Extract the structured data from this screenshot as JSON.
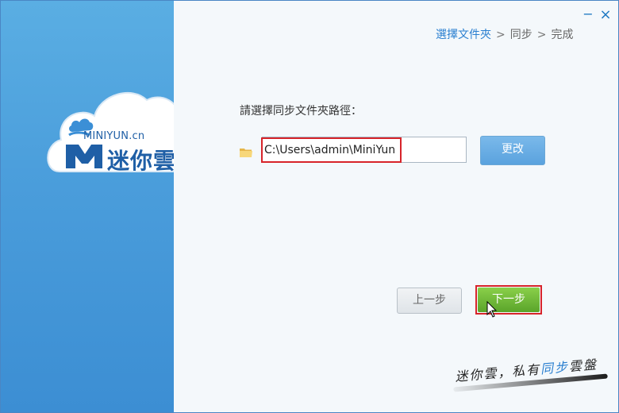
{
  "window": {
    "minimize_glyph": "−",
    "close_glyph": "×"
  },
  "brand": {
    "en": "MINIYUN.cn",
    "cn": "迷你雲"
  },
  "steps": [
    {
      "label": "選擇文件夾",
      "active": true
    },
    {
      "label": "同步",
      "active": false
    },
    {
      "label": "完成",
      "active": false
    }
  ],
  "steps_separator": ">",
  "form": {
    "label": "請選擇同步文件夾路徑：",
    "path_value": "C:\\Users\\admin\\MiniYun",
    "change_label": "更改"
  },
  "nav": {
    "prev_label": "上一步",
    "next_label": "下一步"
  },
  "slogan": {
    "part1": "迷你雲，私有",
    "highlight": "同步",
    "part2": "雲盤"
  },
  "colors": {
    "accent": "#2a7fd0",
    "sidebar": "#4a9ddb",
    "next": "#6ab834",
    "highlight_border": "#d7242a"
  },
  "icons": {
    "folder": "folder-icon",
    "cloud": "cloud-logo-icon",
    "cursor": "mouse-cursor-icon"
  }
}
